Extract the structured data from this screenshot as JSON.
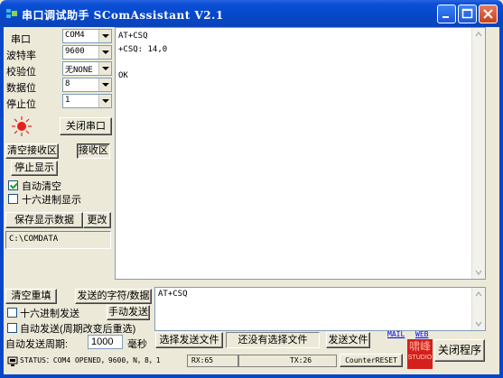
{
  "window": {
    "title": "串口调试助手 SComAssistant V2.1"
  },
  "settings": {
    "port_label": "串口",
    "port_value": "COM4",
    "baud_label": "波特率",
    "baud_value": "9600",
    "parity_label": "校验位",
    "parity_value": "无NONE",
    "databits_label": "数据位",
    "databits_value": "8",
    "stopbits_label": "停止位",
    "stopbits_value": "1"
  },
  "controls": {
    "close_port": "关闭串口",
    "clear_receive": "清空接收区",
    "receive_area": "接收区",
    "stop_display": "停止显示",
    "auto_clear": "自动清空",
    "hex_display": "十六进制显示",
    "save_data": "保存显示数据",
    "change": "更改",
    "save_path": "C:\\COMDATA"
  },
  "receive": {
    "lines": [
      "AT+CSQ",
      "+CSQ: 14,0",
      "",
      "OK"
    ]
  },
  "send": {
    "clear_resend": "清空重填",
    "send_chars_label": "发送的字符/数据",
    "hex_send": "十六进制发送",
    "manual_send": "手动发送",
    "auto_send": "自动发送(周期改变后重选)",
    "auto_period_label": "自动发送周期:",
    "period_value": "1000",
    "ms_label": "毫秒",
    "choose_file": "选择发送文件",
    "no_file": "还没有选择文件",
    "send_file": "发送文件",
    "send_text": "AT+CSQ",
    "mail_link": "MAIL",
    "web_link": "WEB",
    "close_program": "关闭程序",
    "logo_text": "啸峰",
    "logo_sub": "STUDIO"
  },
  "status": {
    "status_text": "STATUS：COM4 OPENED，9600，N，8，1",
    "rx": "RX:65",
    "tx": "TX:26",
    "counter_reset": "CounterRESET"
  },
  "colors": {
    "titlebar": "#0647c8",
    "face": "#ECE9D8",
    "indicator": "#e8201a",
    "logo_red": "#d4201a",
    "link_blue": "#0000ff"
  }
}
